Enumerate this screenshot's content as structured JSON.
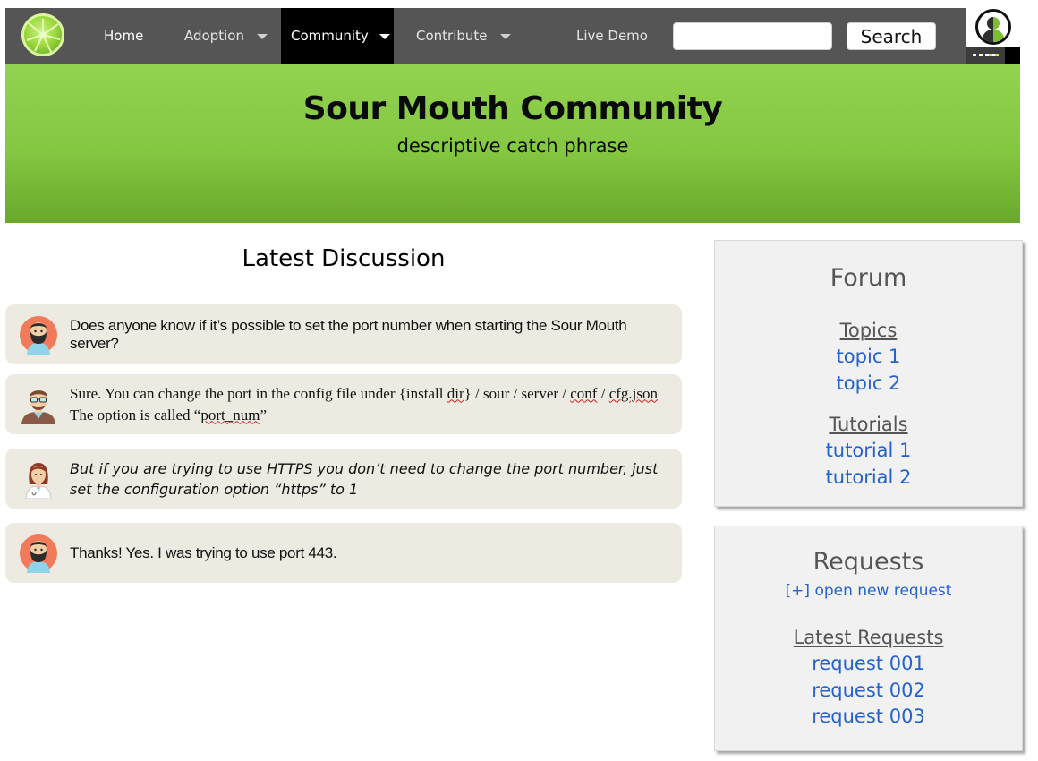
{
  "nav": {
    "logo_icon": "lime-slice-icon",
    "items": [
      {
        "label": "Home"
      },
      {
        "label": "Adoption",
        "has_dropdown": true
      },
      {
        "label": "Community",
        "has_dropdown": true,
        "active": true
      },
      {
        "label": "Contribute",
        "has_dropdown": true
      },
      {
        "label": "Live Demo"
      }
    ],
    "search": {
      "value": "",
      "placeholder": "",
      "button_label": "Search"
    },
    "profile_icon": "user-avatar-icon"
  },
  "hero": {
    "title": "Sour Mouth Community",
    "tagline": "descriptive catch phrase"
  },
  "discussion": {
    "title": "Latest Discussion",
    "messages": [
      {
        "avatar_icon": "bearded-man-avatar-icon",
        "text": "Does anyone know if it’s possible to set the port number when starting the Sour Mouth server?"
      },
      {
        "avatar_icon": "man-with-glasses-avatar-icon",
        "text_parts": [
          "Sure. You can change the port in the config file under {install ",
          "dir",
          "} / sour / server / ",
          "conf",
          " / ",
          "cfg.json",
          " The option is called “",
          "port_num",
          "”"
        ]
      },
      {
        "avatar_icon": "woman-doctor-avatar-icon",
        "text": "But if you are trying to use HTTPS you don’t need to change the port number, just set the configuration option “https” to 1"
      },
      {
        "avatar_icon": "bearded-man-avatar-icon",
        "text": "Thanks! Yes. I was trying to use port 443."
      }
    ]
  },
  "forum": {
    "title": "Forum",
    "topics_heading": "Topics",
    "topics": [
      "topic 1",
      "topic 2"
    ],
    "tutorials_heading": "Tutorials",
    "tutorials": [
      "tutorial 1",
      "tutorial 2"
    ]
  },
  "requests": {
    "title": "Requests",
    "open_new_label": "[+] open new request",
    "latest_heading": "Latest Requests",
    "items": [
      "request 001",
      "request 002",
      "request 003"
    ]
  },
  "colors": {
    "nav_bg": "#555555",
    "nav_active_bg": "#000000",
    "hero_green": "#8ccf4a",
    "message_bg": "#edeae1",
    "panel_bg": "#f1f1f1",
    "link_blue": "#2463cf"
  }
}
